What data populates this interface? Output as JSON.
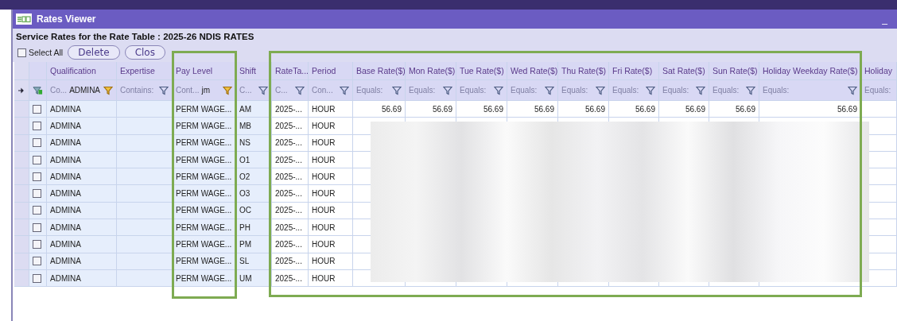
{
  "window": {
    "title": "Rates Viewer",
    "minimize": "_"
  },
  "heading": "Service Rates for the Rate Table : 2025-26 NDIS RATES",
  "select_all": {
    "label": "Select All",
    "checked": false
  },
  "buttons": [
    "Delete",
    "Clos"
  ],
  "columns": [
    "Qualification",
    "Expertise",
    "Pay Level",
    "Shift",
    "RateTa...",
    "Period",
    "Base Rate($)",
    "Mon Rate($)",
    "Tue Rate($)",
    "Wed Rate($)",
    "Thu Rate($)",
    "Fri Rate($)",
    "Sat Rate($)",
    "Sun Rate($)",
    "Holiday Weekday Rate($)",
    "Holiday"
  ],
  "filters": [
    {
      "operator": "Co...",
      "value": "ADMINA",
      "active": true
    },
    {
      "operator": "Contains:",
      "active": false
    },
    {
      "operator": "Cont...",
      "value": "jm",
      "active": true
    },
    {
      "operator": "C...",
      "active": false
    },
    {
      "operator": "C...",
      "active": false
    },
    {
      "operator": "Con...",
      "active": false
    },
    {
      "operator": "Equals:",
      "active": false
    },
    {
      "operator": "Equals:",
      "active": false
    },
    {
      "operator": "Equals:",
      "active": false
    },
    {
      "operator": "Equals:",
      "active": false
    },
    {
      "operator": "Equals:",
      "active": false
    },
    {
      "operator": "Equals:",
      "active": false
    },
    {
      "operator": "Equals:",
      "active": false
    },
    {
      "operator": "Equals:",
      "active": false
    },
    {
      "operator": "Equals:",
      "active": false
    },
    {
      "operator": "Equals:"
    }
  ],
  "rows": [
    {
      "checked": false,
      "qualification": "ADMINA",
      "pay_level": "PERM WAGE...",
      "shift": "AM",
      "rate_table": "2025-...",
      "period": "HOUR",
      "rates": [
        "56.69",
        "56.69",
        "56.69",
        "56.69",
        "56.69",
        "56.69",
        "56.69",
        "56.69",
        "56.69"
      ]
    },
    {
      "checked": false,
      "qualification": "ADMINA",
      "pay_level": "PERM WAGE...",
      "shift": "MB",
      "rate_table": "2025-...",
      "period": "HOUR"
    },
    {
      "checked": false,
      "qualification": "ADMINA",
      "pay_level": "PERM WAGE...",
      "shift": "NS",
      "rate_table": "2025-...",
      "period": "HOUR"
    },
    {
      "checked": false,
      "qualification": "ADMINA",
      "pay_level": "PERM WAGE...",
      "shift": "O1",
      "rate_table": "2025-...",
      "period": "HOUR"
    },
    {
      "checked": false,
      "qualification": "ADMINA",
      "pay_level": "PERM WAGE...",
      "shift": "O2",
      "rate_table": "2025-...",
      "period": "HOUR"
    },
    {
      "checked": false,
      "qualification": "ADMINA",
      "pay_level": "PERM WAGE...",
      "shift": "O3",
      "rate_table": "2025-...",
      "period": "HOUR"
    },
    {
      "checked": false,
      "qualification": "ADMINA",
      "pay_level": "PERM WAGE...",
      "shift": "OC",
      "rate_table": "2025-...",
      "period": "HOUR"
    },
    {
      "checked": false,
      "qualification": "ADMINA",
      "pay_level": "PERM WAGE...",
      "shift": "PH",
      "rate_table": "2025-...",
      "period": "HOUR"
    },
    {
      "checked": false,
      "qualification": "ADMINA",
      "pay_level": "PERM WAGE...",
      "shift": "PM",
      "rate_table": "2025-...",
      "period": "HOUR"
    },
    {
      "checked": false,
      "qualification": "ADMINA",
      "pay_level": "PERM WAGE...",
      "shift": "SL",
      "rate_table": "2025-...",
      "period": "HOUR"
    },
    {
      "checked": false,
      "qualification": "ADMINA",
      "pay_level": "PERM WAGE...",
      "shift": "UM",
      "rate_table": "2025-...",
      "period": "HOUR"
    }
  ]
}
